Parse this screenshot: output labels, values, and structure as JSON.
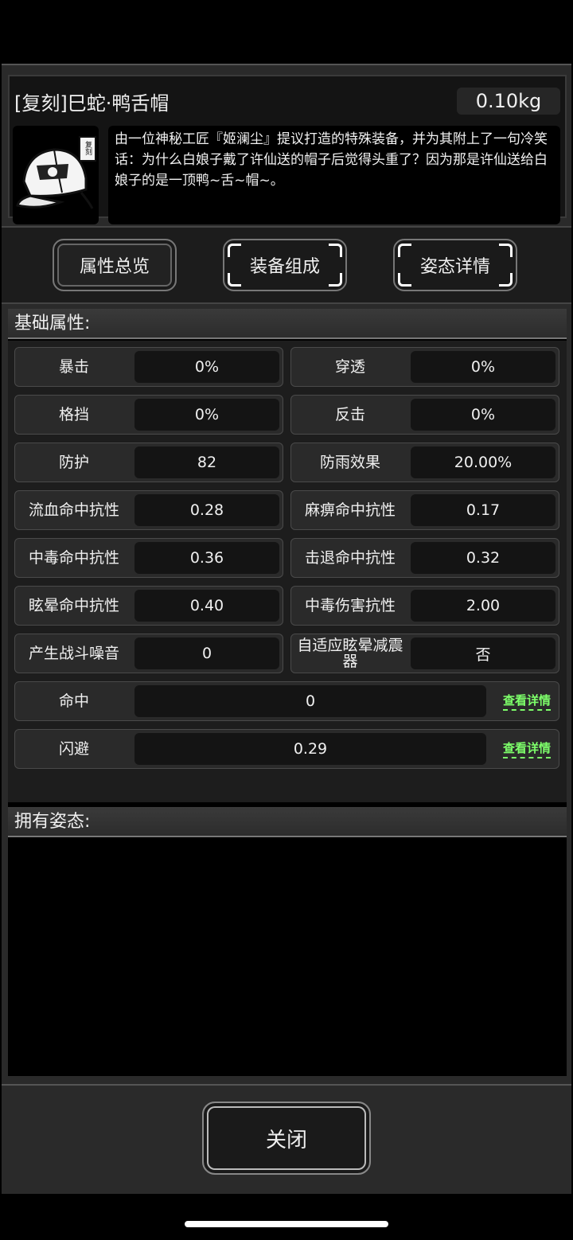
{
  "item": {
    "title": "[复刻]巳蛇·鸭舌帽",
    "weight": "0.10kg",
    "badge": "复刻",
    "description": "由一位神秘工匠『姬澜尘』提议打造的特殊装备，并为其附上了一句冷笑话：为什么白娘子戴了许仙送的帽子后觉得头重了？因为那是许仙送给白娘子的是一顶鸭~舌~帽~。"
  },
  "tabs": [
    {
      "label": "属性总览",
      "active": true
    },
    {
      "label": "装备组成",
      "active": false
    },
    {
      "label": "姿态详情",
      "active": false
    }
  ],
  "basic": {
    "heading": "基础属性:",
    "pairs": [
      [
        {
          "label": "暴击",
          "value": "0%"
        },
        {
          "label": "穿透",
          "value": "0%"
        }
      ],
      [
        {
          "label": "格挡",
          "value": "0%"
        },
        {
          "label": "反击",
          "value": "0%"
        }
      ],
      [
        {
          "label": "防护",
          "value": "82"
        },
        {
          "label": "防雨效果",
          "value": "20.00%"
        }
      ],
      [
        {
          "label": "流血命中抗性",
          "value": "0.28"
        },
        {
          "label": "麻痹命中抗性",
          "value": "0.17"
        }
      ],
      [
        {
          "label": "中毒命中抗性",
          "value": "0.36"
        },
        {
          "label": "击退命中抗性",
          "value": "0.32"
        }
      ],
      [
        {
          "label": "眩晕命中抗性",
          "value": "0.40"
        },
        {
          "label": "中毒伤害抗性",
          "value": "2.00"
        }
      ],
      [
        {
          "label": "产生战斗噪音",
          "value": "0"
        },
        {
          "label": "自适应眩晕减震器",
          "value": "否"
        }
      ]
    ],
    "wide": [
      {
        "label": "命中",
        "value": "0",
        "link": "查看详情"
      },
      {
        "label": "闪避",
        "value": "0.29",
        "link": "查看详情"
      }
    ]
  },
  "stances": {
    "heading": "拥有姿态:"
  },
  "footer": {
    "close_label": "关闭"
  },
  "colors": {
    "link": "#7dff6a",
    "background": "#000000"
  }
}
